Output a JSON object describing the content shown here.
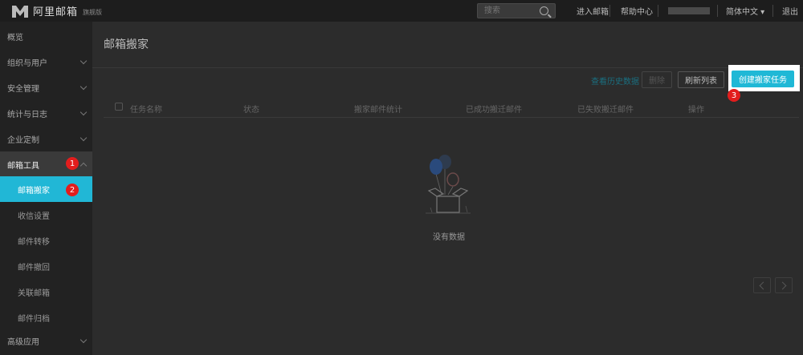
{
  "topbar": {
    "logo_text": "阿里邮箱",
    "logo_badge": "旗舰版",
    "search_placeholder": "搜索",
    "nav": [
      "进入邮箱",
      "帮助中心",
      "简体中文 ▾",
      "退出"
    ]
  },
  "sidebar": {
    "items": [
      {
        "label": "概览"
      },
      {
        "label": "组织与用户"
      },
      {
        "label": "安全管理"
      },
      {
        "label": "统计与日志"
      },
      {
        "label": "企业定制"
      },
      {
        "label": "邮箱工具"
      },
      {
        "label": "邮箱搬家"
      },
      {
        "label": "收信设置"
      },
      {
        "label": "邮件转移"
      },
      {
        "label": "邮件撤回"
      },
      {
        "label": "关联邮箱"
      },
      {
        "label": "邮件归档"
      },
      {
        "label": "高级应用"
      }
    ]
  },
  "main": {
    "title": "邮箱搬家",
    "recent_link": "查看历史数据",
    "delete_label": "删除",
    "refresh_label": "刷新列表",
    "create_label": "创建搬家任务",
    "columns": [
      "任务名称",
      "状态",
      "搬家邮件统计",
      "已成功搬迁邮件",
      "已失败搬迁邮件",
      "操作"
    ],
    "empty_text": "没有数据"
  },
  "steps": [
    "1",
    "2",
    "3"
  ],
  "colors": {
    "accent": "#1fb8d6",
    "step": "#e21d1d"
  }
}
